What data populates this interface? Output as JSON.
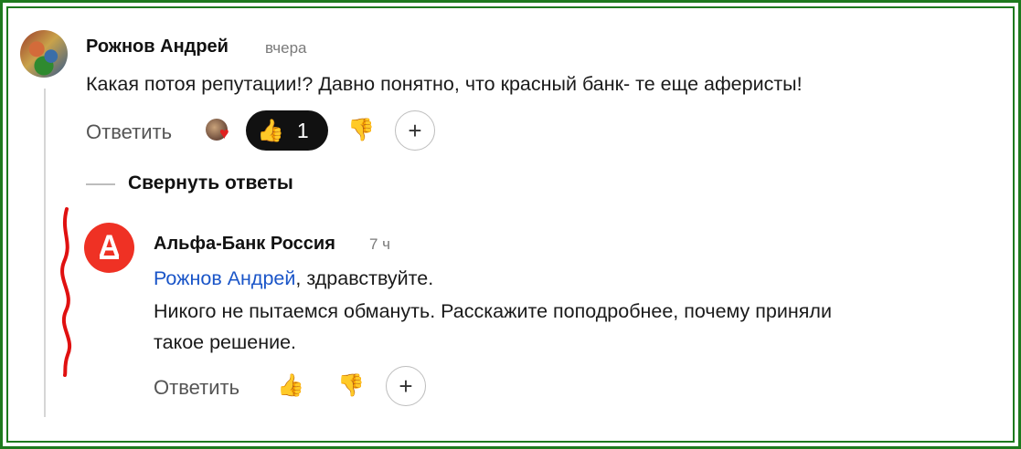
{
  "comment": {
    "author": "Рожнов Андрей",
    "time": "вчера",
    "text": "Какая потоя репутации!? Давно понятно, что красный банк- те еще аферисты!",
    "reply_label": "Ответить",
    "like_count": "1"
  },
  "collapse_label": "Свернуть ответы",
  "reply": {
    "author": "Альфа-Банк Россия",
    "time": "7 ч",
    "mention": "Рожнов Андрей",
    "greeting_rest": ", здравствуйте.",
    "line2": "Никого не пытаемся обмануть. Расскажите поподробнее, почему приняли",
    "line3": "такое решение.",
    "reply_label": "Ответить",
    "logo_letter": "А"
  },
  "icons": {
    "like": "👍",
    "dislike": "👎",
    "plus": "+",
    "heart": "♥"
  },
  "colors": {
    "frame": "#1e7a1e",
    "brand_red": "#ef3124",
    "link": "#1a55c8",
    "annotation": "#e01010"
  }
}
